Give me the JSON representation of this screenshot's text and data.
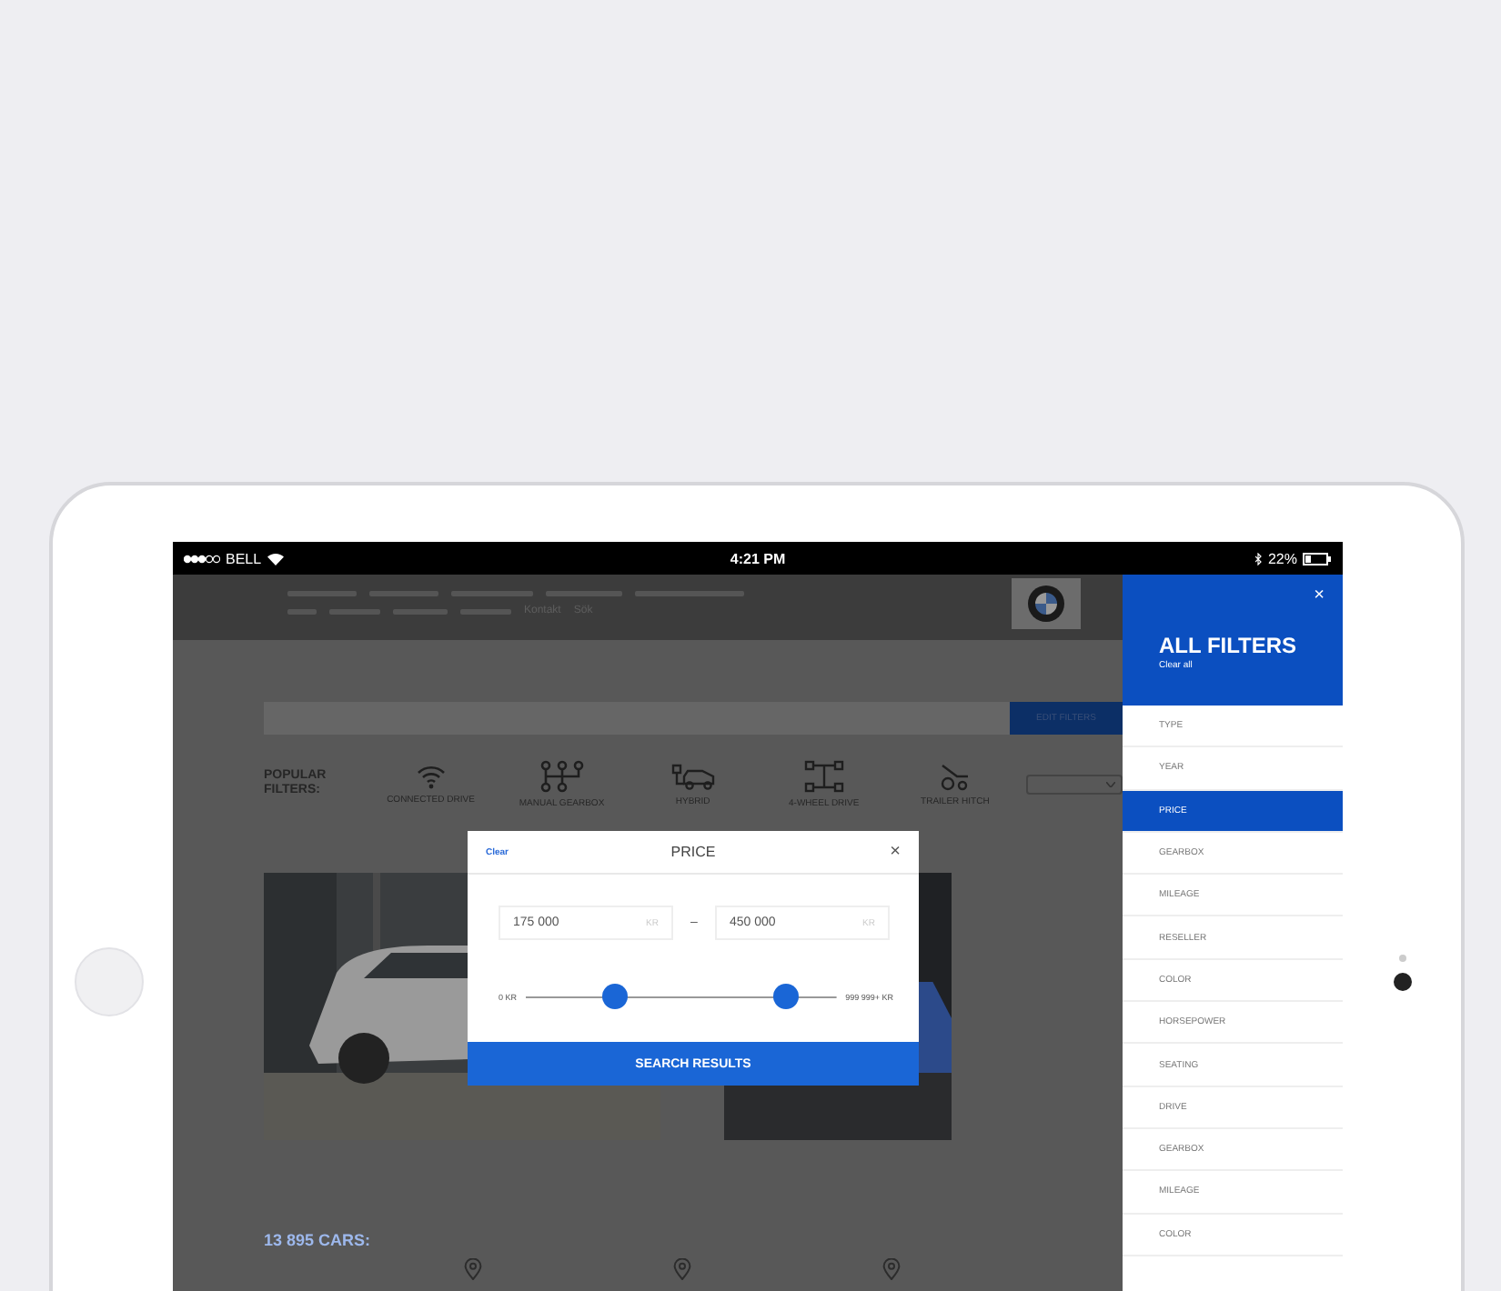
{
  "status_bar": {
    "carrier": "BELL",
    "time": "4:21 PM",
    "battery": "22%"
  },
  "header": {
    "links_secondary": [
      "Kontakt",
      "Sök"
    ]
  },
  "search": {
    "button": "EDIT FILTERS"
  },
  "popular_filters": {
    "label": "POPULAR FILTERS:",
    "items": [
      {
        "kind": "wifi",
        "label": "CONNECTED DRIVE"
      },
      {
        "kind": "gearbox",
        "label": "MANUAL GEARBOX"
      },
      {
        "kind": "hybrid",
        "label": "HYBRID"
      },
      {
        "kind": "awd",
        "label": "4-WHEEL DRIVE"
      },
      {
        "kind": "hitch",
        "label": "TRAILER HITCH"
      }
    ]
  },
  "result_count": "13 895 CARS:",
  "price_modal": {
    "clear": "Clear",
    "title": "PRICE",
    "close": "×",
    "min": {
      "value": "175 000",
      "unit": "KR"
    },
    "separator": "–",
    "max": {
      "value": "450 000",
      "unit": "KR"
    },
    "range_start": "0 KR",
    "range_end": "999 999+ KR",
    "thumbs": [
      {
        "level": 0.29
      },
      {
        "level": 0.84
      }
    ],
    "button": "SEARCH RESULTS"
  },
  "drawer": {
    "title": "ALL FILTERS",
    "clear_all": "Clear all",
    "close": "×",
    "items": [
      {
        "label": "TYPE",
        "selected": false
      },
      {
        "label": "YEAR",
        "selected": false
      },
      {
        "label": "PRICE",
        "selected": true
      },
      {
        "label": "GEARBOX",
        "selected": false
      },
      {
        "label": "MILEAGE",
        "selected": false
      },
      {
        "label": "RESELLER",
        "selected": false
      },
      {
        "label": "COLOR",
        "selected": false
      },
      {
        "label": "HORSEPOWER",
        "selected": false
      },
      {
        "label": "SEATING",
        "selected": false
      },
      {
        "label": "DRIVE",
        "selected": false
      },
      {
        "label": "GEARBOX",
        "selected": false
      },
      {
        "label": "MILEAGE",
        "selected": false
      },
      {
        "label": "COLOR",
        "selected": false
      }
    ]
  }
}
